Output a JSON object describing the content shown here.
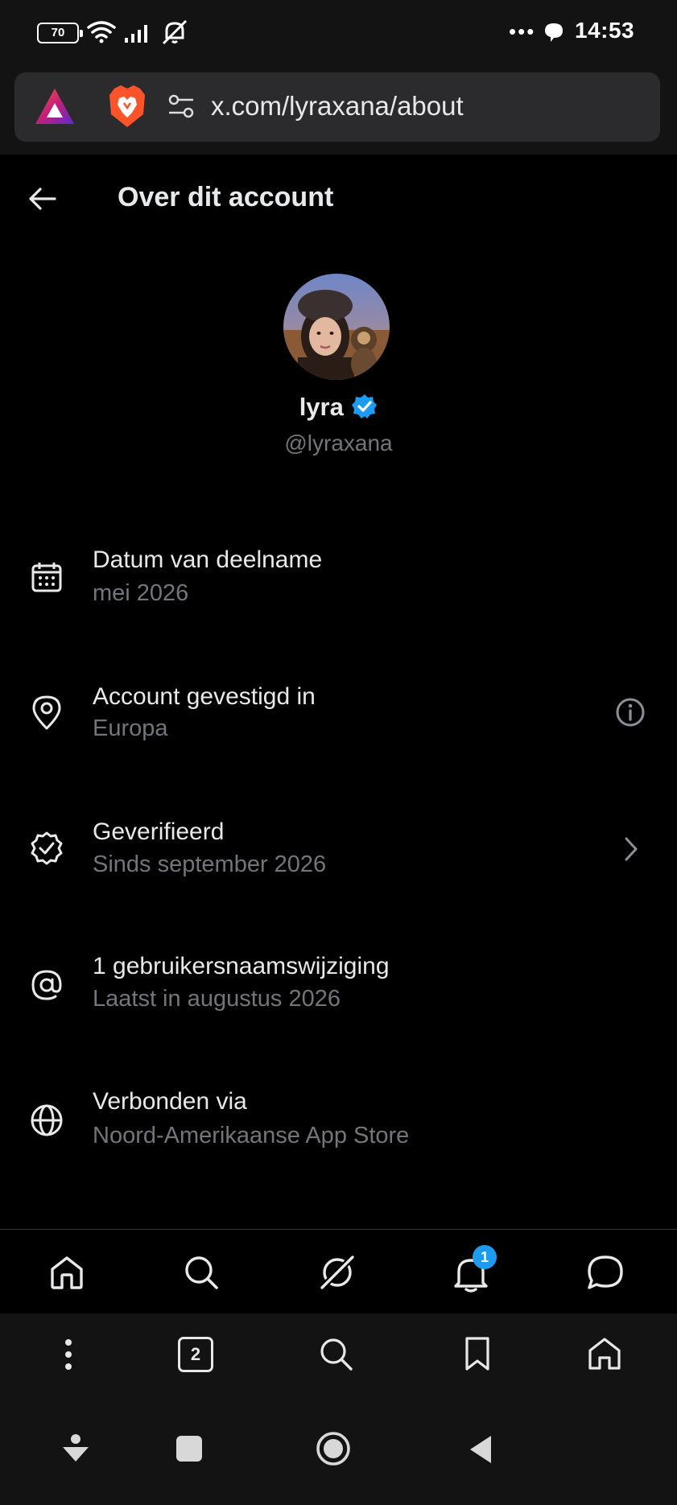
{
  "status_bar": {
    "battery": "70",
    "time": "14:53"
  },
  "browser": {
    "url": "x.com/lyraxana/about",
    "tab_count": "2"
  },
  "header": {
    "title": "Over dit account"
  },
  "profile": {
    "name": "lyra",
    "handle": "@lyraxana",
    "verified": true
  },
  "info_rows": [
    {
      "icon": "calendar-icon",
      "title": "Datum van deelname",
      "subtitle": "mei 2026"
    },
    {
      "icon": "location-pin-icon",
      "title": "Account gevestigd in",
      "subtitle": "Europa",
      "trailing": "info-icon"
    },
    {
      "icon": "verified-badge-icon",
      "title": "Geverifieerd",
      "subtitle": "Sinds september 2026",
      "trailing": "chevron-right-icon"
    },
    {
      "icon": "at-sign-icon",
      "title": "1 gebruikersnaamswijziging",
      "subtitle": "Laatst in augustus 2026"
    },
    {
      "icon": "globe-icon",
      "title": "Verbonden via",
      "subtitle": "Noord-Amerikaanse App Store"
    }
  ],
  "tab_bar": {
    "items": [
      "home-icon",
      "search-icon",
      "grok-icon",
      "notifications-icon",
      "messages-icon"
    ],
    "notification_badge": "1"
  },
  "colors": {
    "background": "#000000",
    "primary_text": "#e7e9ea",
    "secondary_text": "#71767b",
    "accent": "#1d9bf0",
    "chrome": "#131313"
  }
}
